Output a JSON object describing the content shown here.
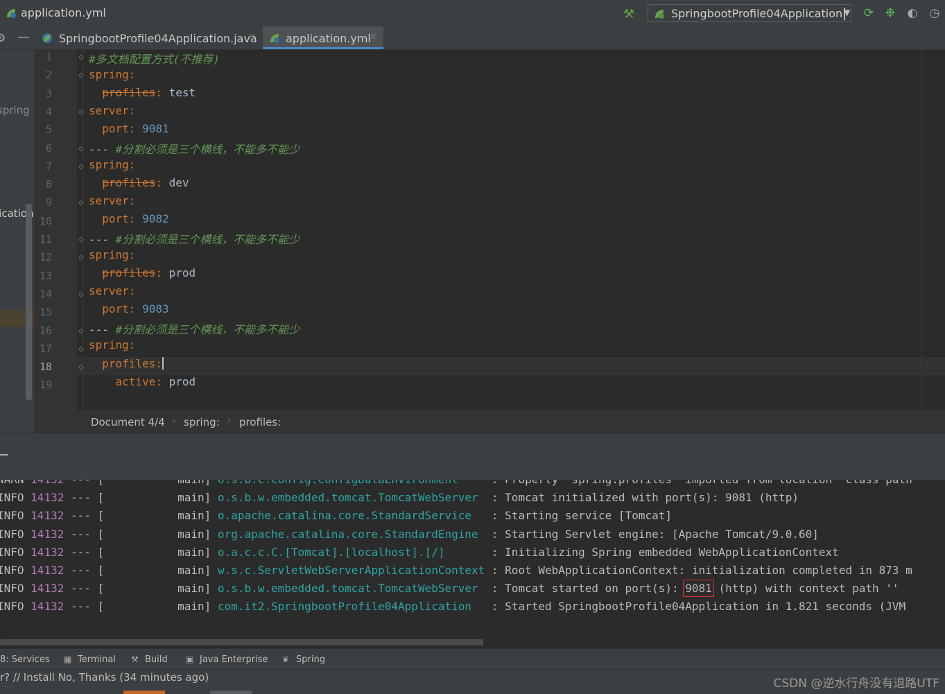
{
  "window": {
    "title": "application.yml",
    "run_config": "SpringbootProfile04Application"
  },
  "tabs": [
    {
      "label": "SpringbootProfile04Application.java",
      "close": "×"
    },
    {
      "label": "application.yml",
      "close": "×"
    }
  ],
  "project": {
    "item1": "spring",
    "item2": "lication"
  },
  "editor": {
    "line_numbers": [
      "1",
      "2",
      "3",
      "4",
      "5",
      "6",
      "7",
      "8",
      "9",
      "10",
      "11",
      "12",
      "13",
      "14",
      "15",
      "16",
      "17",
      "18",
      "19"
    ],
    "lines": {
      "l1": "#多文档配置方式(不推荐)",
      "l2_key": "spring",
      "l3_key": "profiles",
      "l3_val": "test",
      "l4_key": "server",
      "l5_key": "port",
      "l5_val": "9081",
      "l6_sep": "---",
      "l6_comment": "#分割必须是三个横线，不能多不能少",
      "l7_key": "spring",
      "l8_key": "profiles",
      "l8_val": "dev",
      "l9_key": "server",
      "l10_key": "port",
      "l10_val": "9082",
      "l11_sep": "---",
      "l11_comment": "#分割必须是三个横线，不能多不能少",
      "l12_key": "spring",
      "l13_key": "profiles",
      "l13_val": "prod",
      "l14_key": "server",
      "l15_key": "port",
      "l15_val": "9083",
      "l16_sep": "---",
      "l16_comment": "#分割必须是三个横线，不能多不能少",
      "l17_key": "spring",
      "l18_key": "profiles",
      "l19_key": "active",
      "l19_val": "prod"
    }
  },
  "breadcrumb": {
    "doc": "Document 4/4",
    "item1": "spring:",
    "item2": "profiles:"
  },
  "console": {
    "lines": [
      {
        "level": "WARN",
        "pid": "14132",
        "sep": "---",
        "bracket": "[",
        "thread": "main]",
        "logger": "o.s.b.c.config.ConfigDataEnvironment",
        "msg": ": Property 'spring.profiles' imported from location 'class path"
      },
      {
        "level": "INFO",
        "pid": "14132",
        "sep": "---",
        "bracket": "[",
        "thread": "main]",
        "logger": "o.s.b.w.embedded.tomcat.TomcatWebServer",
        "msg": ": Tomcat initialized with port(s): 9081 (http)"
      },
      {
        "level": "INFO",
        "pid": "14132",
        "sep": "---",
        "bracket": "[",
        "thread": "main]",
        "logger": "o.apache.catalina.core.StandardService",
        "msg": ": Starting service [Tomcat]"
      },
      {
        "level": "INFO",
        "pid": "14132",
        "sep": "---",
        "bracket": "[",
        "thread": "main]",
        "logger": "org.apache.catalina.core.StandardEngine",
        "msg": ": Starting Servlet engine: [Apache Tomcat/9.0.60]"
      },
      {
        "level": "INFO",
        "pid": "14132",
        "sep": "---",
        "bracket": "[",
        "thread": "main]",
        "logger": "o.a.c.c.C.[Tomcat].[localhost].[/]",
        "msg": ": Initializing Spring embedded WebApplicationContext"
      },
      {
        "level": "INFO",
        "pid": "14132",
        "sep": "---",
        "bracket": "[",
        "thread": "main]",
        "logger": "w.s.c.ServletWebServerApplicationContext",
        "msg": ": Root WebApplicationContext: initialization completed in 873 m"
      },
      {
        "level": "INFO",
        "pid": "14132",
        "sep": "---",
        "bracket": "[",
        "thread": "main]",
        "logger": "o.s.b.w.embedded.tomcat.TomcatWebServer",
        "msg_pre": ": Tomcat started on port(s):",
        "msg_hl": "9081",
        "msg_post": "(http) with context path ''"
      },
      {
        "level": "INFO",
        "pid": "14132",
        "sep": "---",
        "bracket": "[",
        "thread": "main]",
        "logger": "com.it2.SpringbootProfile04Application",
        "msg": ": Started SpringbootProfile04Application in 1.821 seconds (JVM"
      }
    ]
  },
  "toolwindows": [
    {
      "label": "8: Services",
      "icon": "services-icon"
    },
    {
      "label": "Terminal",
      "icon": "terminal-icon"
    },
    {
      "label": "Build",
      "icon": "build-icon"
    },
    {
      "label": "Java Enterprise",
      "icon": "java-enterprise-icon"
    },
    {
      "label": "Spring",
      "icon": "spring-icon"
    }
  ],
  "status": {
    "message": "r? // Install   No, Thanks (34 minutes ago)",
    "watermark": "CSDN @逆水行舟没有退路UTF"
  },
  "colors": {
    "keyword": "#cc7832",
    "number": "#6897bb",
    "comment": "#629755",
    "logger": "#2fa5a5",
    "pid": "#b07cb4",
    "active_tab_underline": "#4a88c7",
    "highlight_box": "#e03030"
  }
}
